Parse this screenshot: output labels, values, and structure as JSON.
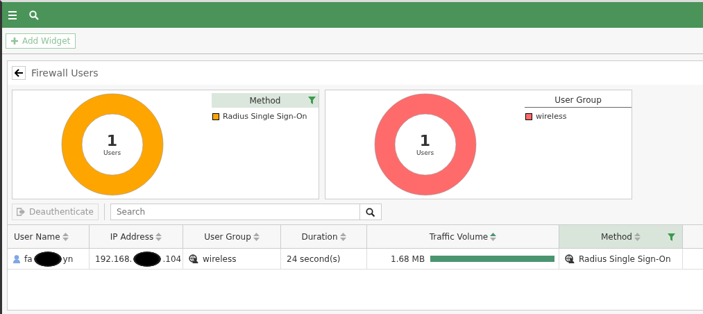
{
  "toolbar": {
    "add_widget": "Add Widget"
  },
  "widget": {
    "title": "Firewall Users",
    "charts": [
      {
        "legend_title": "Method",
        "legend_filtered": true,
        "center_value": "1",
        "center_label": "Users",
        "legend": [
          {
            "label": "Radius Single Sign-On",
            "color": "#ffa500"
          }
        ]
      },
      {
        "legend_title": "User Group",
        "legend_filtered": false,
        "center_value": "1",
        "center_label": "Users",
        "legend": [
          {
            "label": "wireless",
            "color": "#ff6b6b"
          }
        ]
      }
    ],
    "deauth_button": {
      "label": "Deauthenticate",
      "disabled": true
    },
    "search": {
      "placeholder": "Search"
    },
    "table": {
      "columns": [
        {
          "label": "User Name",
          "sorted": false,
          "filtered": false
        },
        {
          "label": "IP Address",
          "sorted": false,
          "filtered": false
        },
        {
          "label": "User Group",
          "sorted": false,
          "filtered": false
        },
        {
          "label": "Duration",
          "sorted": false,
          "filtered": false
        },
        {
          "label": "Traffic Volume",
          "sorted": true,
          "filtered": false
        },
        {
          "label": "Method",
          "sorted": false,
          "filtered": true
        }
      ],
      "rows": [
        {
          "cells": [
            {
              "kind": "user",
              "before": "fa",
              "after": "yn"
            },
            {
              "kind": "redacted",
              "before": "192.168.",
              "after": ".104"
            },
            {
              "kind": "group",
              "text": "wireless"
            },
            {
              "kind": "text",
              "text": "24 second(s)"
            },
            {
              "kind": "traffic",
              "text": "1.68 MB",
              "level": 1
            },
            {
              "kind": "group",
              "text": "Radius Single Sign-On"
            }
          ]
        }
      ]
    }
  }
}
